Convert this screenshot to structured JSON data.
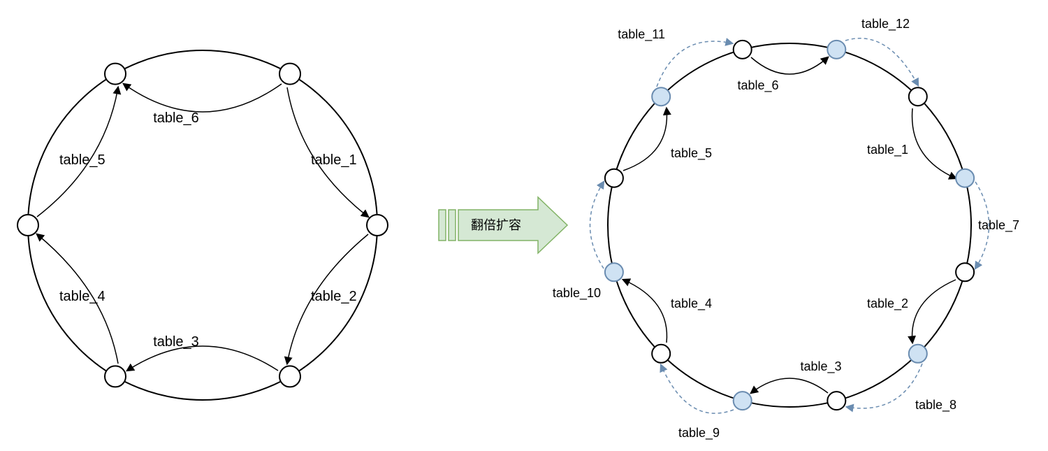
{
  "arrow_label": "翻倍扩容",
  "left_ring": {
    "nodes": 6,
    "labels": [
      "table_1",
      "table_2",
      "table_3",
      "table_4",
      "table_5",
      "table_6"
    ]
  },
  "right_ring": {
    "nodes": 12,
    "labels_old": [
      "table_1",
      "table_2",
      "table_3",
      "table_4",
      "table_5",
      "table_6"
    ],
    "labels_new": [
      "table_7",
      "table_8",
      "table_9",
      "table_10",
      "table_11",
      "table_12"
    ]
  }
}
